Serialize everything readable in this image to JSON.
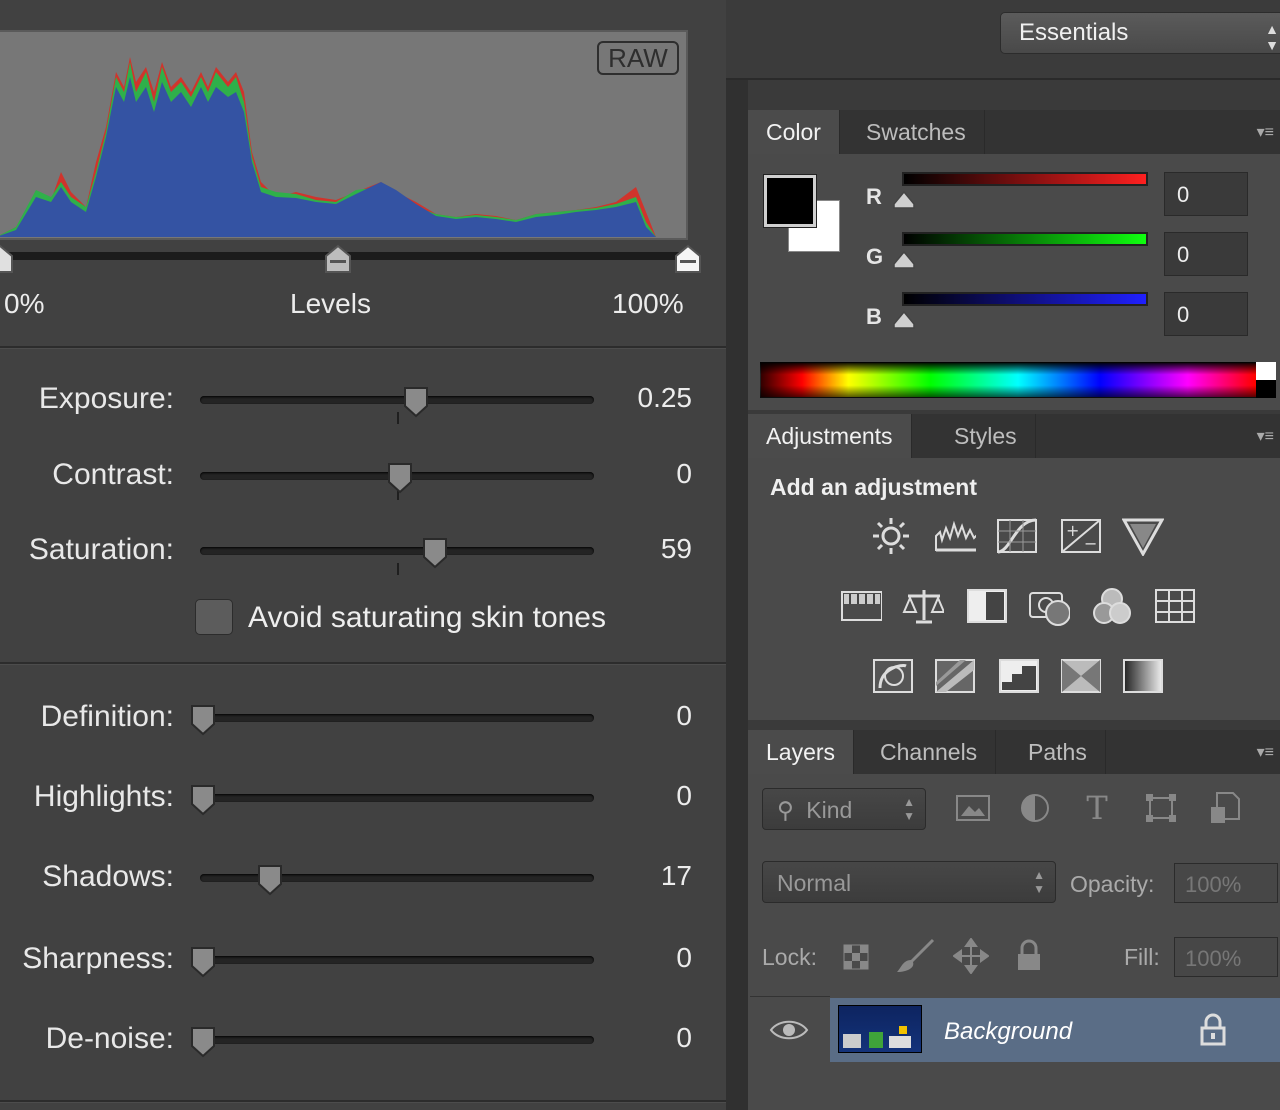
{
  "histogram": {
    "badge": "RAW",
    "levels_left": "0%",
    "levels_center": "Levels",
    "levels_right": "100%"
  },
  "adjustments": [
    {
      "label": "Exposure:",
      "value": "0.25",
      "position": 0.54
    },
    {
      "label": "Contrast:",
      "value": "0",
      "position": 0.5
    },
    {
      "label": "Saturation:",
      "value": "59",
      "position": 0.59
    },
    {
      "label": "Definition:",
      "value": "0",
      "position": 0.0
    },
    {
      "label": "Highlights:",
      "value": "0",
      "position": 0.0
    },
    {
      "label": "Shadows:",
      "value": "17",
      "position": 0.17
    },
    {
      "label": "Sharpness:",
      "value": "0",
      "position": 0.0
    },
    {
      "label": "De-noise:",
      "value": "0",
      "position": 0.0
    }
  ],
  "skin_tones_label": "Avoid saturating skin tones",
  "workspace": "Essentials",
  "color_panel": {
    "tabs": [
      "Color",
      "Swatches"
    ],
    "channels": [
      {
        "label": "R",
        "value": "0",
        "color": "#ff2020"
      },
      {
        "label": "G",
        "value": "0",
        "color": "#10ff10"
      },
      {
        "label": "B",
        "value": "0",
        "color": "#2020ff"
      }
    ]
  },
  "adjustments_panel": {
    "tabs": [
      "Adjustments",
      "Styles"
    ],
    "title": "Add an adjustment",
    "icons": [
      [
        "brightness-contrast-icon",
        "levels-icon",
        "curves-icon",
        "exposure-icon",
        "vibrance-icon"
      ],
      [
        "hue-saturation-icon",
        "color-balance-icon",
        "black-white-icon",
        "photo-filter-icon",
        "channel-mixer-icon",
        "color-lookup-icon"
      ],
      [
        "invert-icon",
        "posterize-icon",
        "threshold-icon",
        "selective-color-icon",
        "gradient-map-icon"
      ]
    ]
  },
  "layers_panel": {
    "tabs": [
      "Layers",
      "Channels",
      "Paths"
    ],
    "kind_label": "Kind",
    "blend_mode": "Normal",
    "opacity_label": "Opacity:",
    "opacity_value": "100%",
    "lock_label": "Lock:",
    "fill_label": "Fill:",
    "fill_value": "100%",
    "layer_name": "Background"
  }
}
